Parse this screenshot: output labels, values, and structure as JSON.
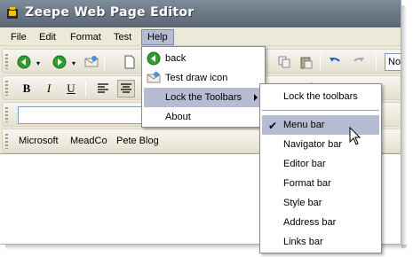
{
  "window": {
    "title": "Zeepe Web Page Editor"
  },
  "menubar": {
    "items": [
      "File",
      "Edit",
      "Format",
      "Test",
      "Help"
    ],
    "active": "Help"
  },
  "help_menu": {
    "items": [
      {
        "label": "back",
        "icon": "back-arrow-icon"
      },
      {
        "label": "Test draw icon",
        "icon": "envelope-icon"
      },
      {
        "label": "Lock the Toolbars",
        "submenu": true
      },
      {
        "label": "About"
      }
    ]
  },
  "lock_submenu": {
    "items": [
      {
        "label": "Lock the toolbars"
      },
      {
        "label": "Menu bar",
        "checked": true
      },
      {
        "label": "Navigator bar"
      },
      {
        "label": "Editor bar"
      },
      {
        "label": "Format bar"
      },
      {
        "label": "Style bar"
      },
      {
        "label": "Address bar"
      },
      {
        "label": "Links bar"
      }
    ]
  },
  "toolbar": {
    "font_box_partial": "No"
  },
  "links_bar": {
    "links": [
      "Microsoft",
      "MeadCo",
      "Pete Blog"
    ]
  },
  "colors": {
    "highlight": "#b6bdd2",
    "chrome": "#ece9d8",
    "title_bar": "#6e7b88",
    "nav_green": "#2e9e2e"
  }
}
